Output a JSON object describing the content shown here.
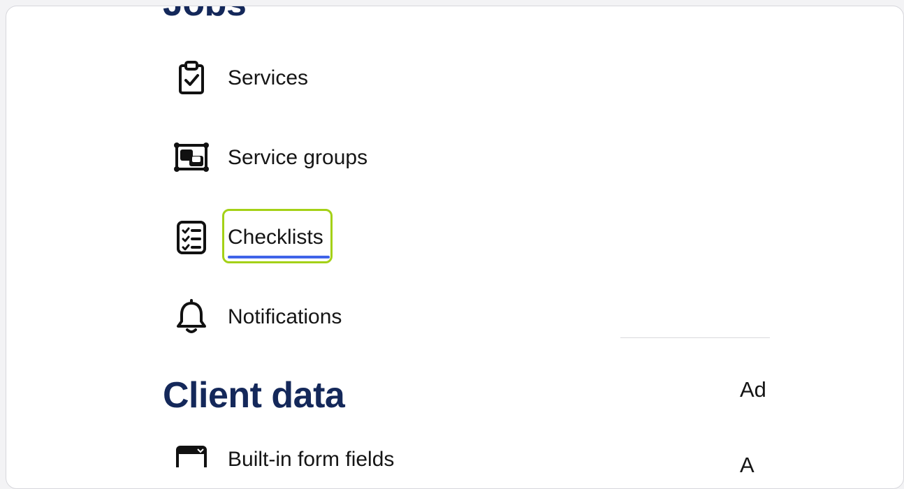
{
  "sections": {
    "jobs_title": "Jobs",
    "client_data_title": "Client data"
  },
  "nav": {
    "items": [
      {
        "label": "Services",
        "icon": "clipboard-check-icon"
      },
      {
        "label": "Service groups",
        "icon": "service-groups-icon"
      },
      {
        "label": "Checklists",
        "icon": "checklist-icon"
      },
      {
        "label": "Notifications",
        "icon": "bell-icon"
      },
      {
        "label": "Built-in form fields",
        "icon": "form-fields-icon"
      }
    ]
  },
  "right_panel": {
    "text_1": "Ad",
    "text_2": "A"
  },
  "colors": {
    "heading": "#14285a",
    "highlight_border": "#a4d117",
    "active_underline": "#3f63e8"
  }
}
